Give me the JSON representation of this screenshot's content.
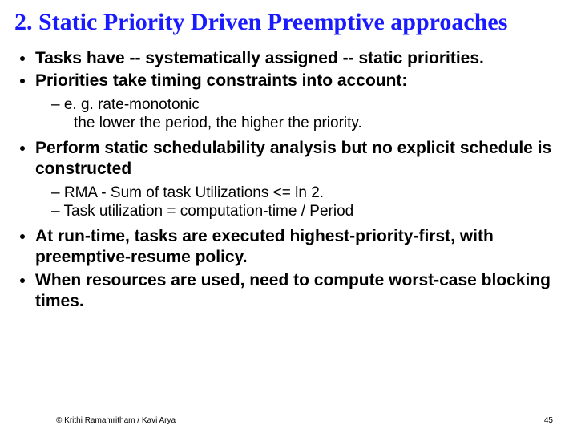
{
  "title": "2. Static Priority Driven Preemptive approaches",
  "b1": "Tasks have -- systematically assigned -- static priorities.",
  "b2": "Priorities  take timing constraints  into account:",
  "b2s1a": "e. g.  rate-monotonic",
  "b2s1b": "the lower the period, the higher the priority.",
  "b3": "Perform static schedulability analysis but no explicit schedule is constructed",
  "b3s1": "RMA  - Sum of task Utilizations <= ln 2.",
  "b3s2": "Task utilization = computation-time  / Period",
  "b4": "At run-time, tasks are executed highest-priority-first, with preemptive-resume policy.",
  "b5": "When resources are used, need to compute worst-case blocking times.",
  "footer_left": "© Krithi Ramamritham / Kavi Arya",
  "footer_right": "45"
}
